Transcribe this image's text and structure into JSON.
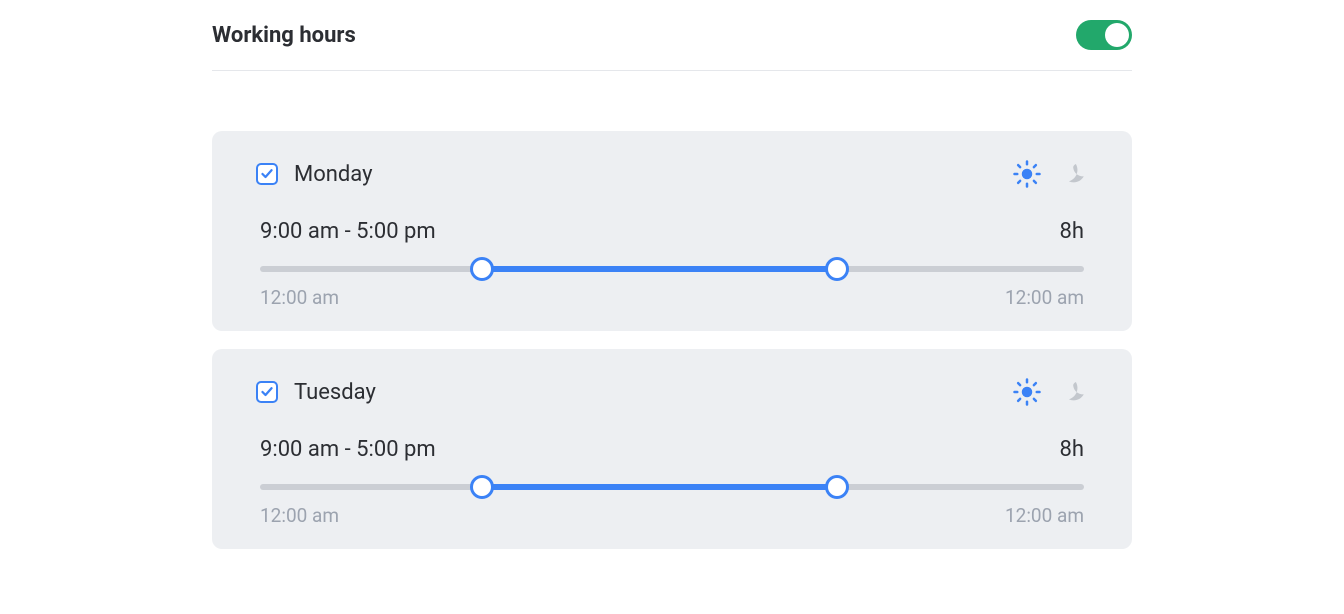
{
  "header": {
    "title": "Working hours",
    "enabled": true
  },
  "slider": {
    "start_label": "12:00 am",
    "end_label": "12:00 am",
    "start_pct": 27,
    "end_pct": 70
  },
  "days": [
    {
      "name": "Monday",
      "checked": true,
      "range": "9:00 am - 5:00 pm",
      "duration": "8h"
    },
    {
      "name": "Tuesday",
      "checked": true,
      "range": "9:00 am - 5:00 pm",
      "duration": "8h"
    }
  ]
}
